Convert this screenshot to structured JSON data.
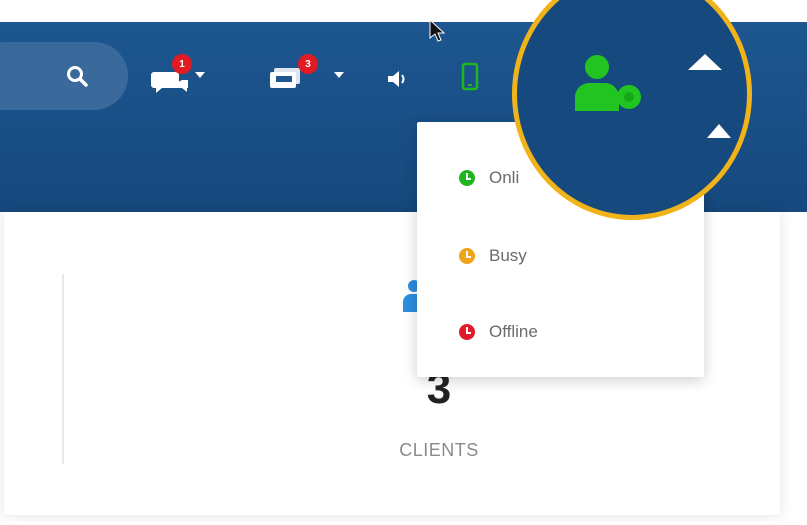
{
  "navbar": {
    "search_icon": "search-icon",
    "messages": {
      "icon": "chat-bubbles-icon",
      "badge": "1"
    },
    "tickets": {
      "icon": "tickets-icon",
      "badge": "3"
    },
    "sound_icon": "speaker-icon",
    "mobile_icon": "mobile-phone-icon",
    "agent_status_icon": "user-status-icon"
  },
  "status_menu": {
    "items": [
      {
        "label": "Onli",
        "color": "#1fb71f"
      },
      {
        "label": "Busy",
        "color": "#f2a31a"
      },
      {
        "label": "Offline",
        "color": "#e21b2a"
      }
    ]
  },
  "dashboard": {
    "clients_count": "3",
    "clients_label": "CLIENTS"
  },
  "colors": {
    "navbar": "#1d5690",
    "highlight": "#f0b41a",
    "status_online": "#1fb71f",
    "badge": "#e11b22"
  }
}
